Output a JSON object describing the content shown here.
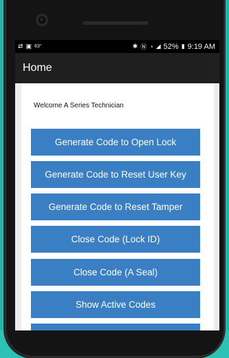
{
  "statusbar": {
    "left_icons": [
      "signal-alt-icon",
      "image-icon"
    ],
    "temperature": "63°",
    "right_icons": [
      "bluetooth-icon",
      "nfc-icon",
      "wifi-icon",
      "signal-icon"
    ],
    "battery_percent": "52%",
    "time": "9:19 AM"
  },
  "appbar": {
    "title": "Home"
  },
  "main": {
    "welcome": "Welcome A Series Technician",
    "buttons": [
      {
        "label": "Generate Code to Open Lock"
      },
      {
        "label": "Generate Code to Reset User Key"
      },
      {
        "label": "Generate Code to Reset Tamper"
      },
      {
        "label": "Close Code (Lock ID)"
      },
      {
        "label": "Close Code (A Seal)"
      },
      {
        "label": "Show Active Codes"
      },
      {
        "label": ""
      }
    ]
  }
}
